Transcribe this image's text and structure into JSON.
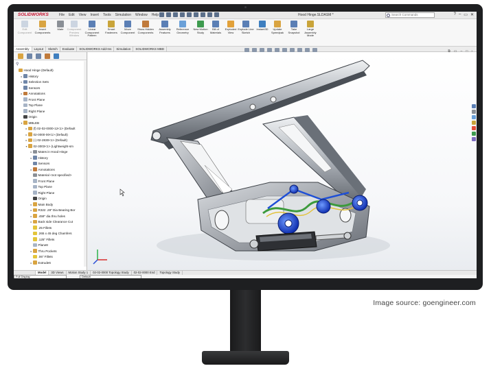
{
  "credit": "Image source: goengineer.com",
  "app": {
    "logo": "SOLIDWORKS",
    "document_title": "Hood Hinge.SLDASM *",
    "menu": [
      "File",
      "Edit",
      "View",
      "Insert",
      "Tools",
      "Simulation",
      "Window",
      "Help"
    ],
    "search_placeholder": "Search Commands"
  },
  "ribbon": [
    {
      "label": "Edit Component",
      "icon": "edit-component-icon",
      "disabled": true
    },
    {
      "label": "Insert Components",
      "icon": "insert-components-icon",
      "disabled": false
    },
    {
      "label": "Mate",
      "icon": "mate-icon",
      "disabled": false
    },
    {
      "label": "Component Preview Window",
      "icon": "component-preview-icon",
      "disabled": true
    },
    {
      "label": "Linear Component Pattern",
      "icon": "linear-pattern-icon",
      "disabled": false
    },
    {
      "label": "Smart Fasteners",
      "icon": "smart-fasteners-icon",
      "disabled": false
    },
    {
      "label": "Move Component",
      "icon": "move-component-icon",
      "disabled": false
    },
    {
      "label": "Show Hidden Components",
      "icon": "show-hidden-icon",
      "disabled": false
    },
    {
      "label": "Assembly Features",
      "icon": "assembly-features-icon",
      "disabled": false
    },
    {
      "label": "Reference Geometry",
      "icon": "reference-geometry-icon",
      "disabled": false
    },
    {
      "label": "New Motion Study",
      "icon": "motion-study-icon",
      "disabled": false
    },
    {
      "label": "Bill of Materials",
      "icon": "bom-icon",
      "disabled": false
    },
    {
      "label": "Exploded View",
      "icon": "exploded-view-icon",
      "disabled": false
    },
    {
      "label": "Explode Line Sketch",
      "icon": "explode-line-icon",
      "disabled": false
    },
    {
      "label": "Instant3D",
      "icon": "instant3d-icon",
      "disabled": false
    },
    {
      "label": "Update Speedpak",
      "icon": "speedpak-icon",
      "disabled": false
    },
    {
      "label": "Take Snapshot",
      "icon": "snapshot-icon",
      "disabled": false
    },
    {
      "label": "Large Assembly Mode",
      "icon": "large-assembly-icon",
      "disabled": false
    }
  ],
  "tabs": [
    "Assembly",
    "Layout",
    "Sketch",
    "Evaluate",
    "SOLIDWORKS Add-Ins",
    "Simulation",
    "SOLIDWORKS MBD"
  ],
  "tree": [
    {
      "label": "Hood Hinge (Default)",
      "indent": 0,
      "icon": "assembly-icon",
      "toggle": ""
    },
    {
      "label": "History",
      "indent": 1,
      "icon": "history-icon",
      "toggle": "▸"
    },
    {
      "label": "Selection Sets",
      "indent": 1,
      "icon": "selection-sets-icon",
      "toggle": "▸"
    },
    {
      "label": "Sensors",
      "indent": 1,
      "icon": "sensors-icon",
      "toggle": ""
    },
    {
      "label": "Annotations",
      "indent": 1,
      "icon": "annotations-icon",
      "toggle": "▸"
    },
    {
      "label": "Front Plane",
      "indent": 1,
      "icon": "plane-icon",
      "toggle": ""
    },
    {
      "label": "Top Plane",
      "indent": 1,
      "icon": "plane-icon",
      "toggle": ""
    },
    {
      "label": "Right Plane",
      "indent": 1,
      "icon": "plane-icon",
      "toggle": ""
    },
    {
      "label": "Origin",
      "indent": 1,
      "icon": "origin-icon",
      "toggle": ""
    },
    {
      "label": "MBLEB",
      "indent": 1,
      "icon": "part-icon",
      "toggle": "▾"
    },
    {
      "label": "(f) 02-02-0000-12<1> (Default",
      "indent": 2,
      "icon": "part-icon",
      "toggle": "▸"
    },
    {
      "label": "02-0000-00<1> (Default)",
      "indent": 2,
      "icon": "part-icon",
      "toggle": "▸"
    },
    {
      "label": "(-) 02-2830<1> (Default)",
      "indent": 2,
      "icon": "part-icon",
      "toggle": "▸"
    },
    {
      "label": "02-3003<1> (Lightweight-sm",
      "indent": 2,
      "icon": "part-icon",
      "toggle": "▾"
    },
    {
      "label": "Mates in Hood Hinge",
      "indent": 3,
      "icon": "mates-icon",
      "toggle": "▸"
    },
    {
      "label": "History",
      "indent": 3,
      "icon": "history-icon",
      "toggle": "▸"
    },
    {
      "label": "Sensors",
      "indent": 3,
      "icon": "sensors-icon",
      "toggle": ""
    },
    {
      "label": "Annotations",
      "indent": 3,
      "icon": "annotations-icon",
      "toggle": "▸"
    },
    {
      "label": "Material <not specified>",
      "indent": 3,
      "icon": "material-icon",
      "toggle": ""
    },
    {
      "label": "Front Plane",
      "indent": 3,
      "icon": "plane-icon",
      "toggle": ""
    },
    {
      "label": "Top Plane",
      "indent": 3,
      "icon": "plane-icon",
      "toggle": ""
    },
    {
      "label": "Right Plane",
      "indent": 3,
      "icon": "plane-icon",
      "toggle": ""
    },
    {
      "label": "Origin",
      "indent": 3,
      "icon": "origin-icon",
      "toggle": ""
    },
    {
      "label": "Main Body",
      "indent": 3,
      "icon": "extrude-icon",
      "toggle": "▸"
    },
    {
      "label": "R322 .28\" Dia Bearing Bor",
      "indent": 3,
      "icon": "hole-icon",
      "toggle": "▸"
    },
    {
      "label": ".459\" dia thru holes",
      "indent": 3,
      "icon": "hole-icon",
      "toggle": "▸"
    },
    {
      "label": "Back side Clearance Cut",
      "indent": 3,
      "icon": "cut-icon",
      "toggle": "▸"
    },
    {
      "label": ".25 Fillets",
      "indent": 3,
      "icon": "fillet-icon",
      "toggle": ""
    },
    {
      "label": ".265 x 45 deg Chamfers",
      "indent": 3,
      "icon": "chamfer-icon",
      "toggle": ""
    },
    {
      "label": ".125\" Fillets",
      "indent": 3,
      "icon": "fillet-icon",
      "toggle": ""
    },
    {
      "label": "Plane8",
      "indent": 3,
      "icon": "plane-icon",
      "toggle": ""
    },
    {
      "label": "Thru Pockets",
      "indent": 3,
      "icon": "cut-icon",
      "toggle": "▸"
    },
    {
      "label": ".06\" Fillets",
      "indent": 3,
      "icon": "fillet-icon",
      "toggle": ""
    },
    {
      "label": "Extrude6",
      "indent": 3,
      "icon": "extrude-icon",
      "toggle": "▸"
    }
  ],
  "bottom_tabs": [
    {
      "label": "Model",
      "active": true
    },
    {
      "label": "3D Views",
      "active": false
    },
    {
      "label": "Motion Study 1",
      "active": false
    },
    {
      "label": "02-02-0000 Topology Study",
      "active": false
    },
    {
      "label": "02-02-0000 End",
      "active": false
    },
    {
      "label": "Topology Study",
      "active": false
    }
  ],
  "status": {
    "display_mode": "Full Display",
    "config": "Default"
  },
  "colors": {
    "accent_red": "#c8102e",
    "bearing_blue": "#1e4fd6",
    "spring_green": "#3c9a3c"
  }
}
